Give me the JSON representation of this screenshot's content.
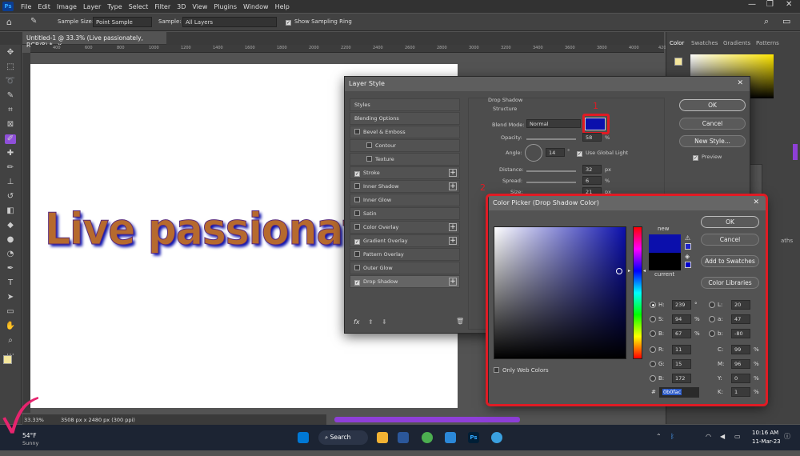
{
  "menu": {
    "logo": "Ps",
    "items": [
      "File",
      "Edit",
      "Image",
      "Layer",
      "Type",
      "Select",
      "Filter",
      "3D",
      "View",
      "Plugins",
      "Window",
      "Help"
    ]
  },
  "options": {
    "sample_size_label": "Sample Size:",
    "sample_size_value": "Point Sample",
    "sample_label": "Sample:",
    "sample_value": "All Layers",
    "show_ring_label": "Show Sampling Ring"
  },
  "document": {
    "tab_title": "Untitled-1 @ 33.3% (Live passionately, RGB/8) *",
    "zoom": "33.33%",
    "size_info": "3508 px x 2480 px (300 ppi)",
    "canvas_text": "Live passionately"
  },
  "ruler_ticks": [
    "400",
    "600",
    "800",
    "1000",
    "1200",
    "1400",
    "1600",
    "1800",
    "2000",
    "2200",
    "2400",
    "2600",
    "2800",
    "3000",
    "3200",
    "3400",
    "3600",
    "3800",
    "4000",
    "4200"
  ],
  "right_panel": {
    "tabs": [
      "Color",
      "Swatches",
      "Gradients",
      "Patterns"
    ],
    "partial": "aths"
  },
  "layer_style": {
    "title": "Layer Style",
    "items": [
      {
        "label": "Styles",
        "check": null,
        "plus": false
      },
      {
        "label": "Blending Options",
        "check": null,
        "plus": false
      },
      {
        "label": "Bevel & Emboss",
        "check": false,
        "plus": false
      },
      {
        "label": "Contour",
        "check": false,
        "plus": false,
        "indent": true
      },
      {
        "label": "Texture",
        "check": false,
        "plus": false,
        "indent": true
      },
      {
        "label": "Stroke",
        "check": true,
        "plus": true
      },
      {
        "label": "Inner Shadow",
        "check": false,
        "plus": true
      },
      {
        "label": "Inner Glow",
        "check": false,
        "plus": false
      },
      {
        "label": "Satin",
        "check": false,
        "plus": false
      },
      {
        "label": "Color Overlay",
        "check": false,
        "plus": true
      },
      {
        "label": "Gradient Overlay",
        "check": true,
        "plus": true
      },
      {
        "label": "Pattern Overlay",
        "check": false,
        "plus": false
      },
      {
        "label": "Outer Glow",
        "check": false,
        "plus": false
      },
      {
        "label": "Drop Shadow",
        "check": true,
        "plus": true,
        "selected": true
      }
    ],
    "fx": "fx",
    "section": "Drop Shadow",
    "subsection": "Structure",
    "blend_mode_label": "Blend Mode:",
    "blend_mode_value": "Normal",
    "opacity_label": "Opacity:",
    "opacity_value": "58",
    "opacity_unit": "%",
    "angle_label": "Angle:",
    "angle_value": "14",
    "angle_unit": "°",
    "global_light_label": "Use Global Light",
    "distance_label": "Distance:",
    "distance_value": "32",
    "distance_unit": "px",
    "spread_label": "Spread:",
    "spread_value": "6",
    "spread_unit": "%",
    "size_label": "Size:",
    "size_value": "21",
    "size_unit": "px",
    "ok": "OK",
    "cancel": "Cancel",
    "new_style": "New Style...",
    "preview": "Preview",
    "shadow_color": "#0b0fac"
  },
  "annotations": {
    "one": "1",
    "two": "2"
  },
  "color_picker": {
    "title": "Color Picker (Drop Shadow Color)",
    "ok": "OK",
    "cancel": "Cancel",
    "add_swatches": "Add to Swatches",
    "color_libraries": "Color Libraries",
    "new_label": "new",
    "current_label": "current",
    "only_web_colors": "Only Web Colors",
    "new_color": "#0b0fac",
    "current_color": "#000000",
    "H": {
      "label": "H:",
      "value": "239",
      "unit": "°"
    },
    "S": {
      "label": "S:",
      "value": "94",
      "unit": "%"
    },
    "Bv": {
      "label": "B:",
      "value": "67",
      "unit": "%"
    },
    "R": {
      "label": "R:",
      "value": "11"
    },
    "G": {
      "label": "G:",
      "value": "15"
    },
    "Bc": {
      "label": "B:",
      "value": "172"
    },
    "L": {
      "label": "L:",
      "value": "20"
    },
    "a": {
      "label": "a:",
      "value": "47"
    },
    "b": {
      "label": "b:",
      "value": "-80"
    },
    "C": {
      "label": "C:",
      "value": "99",
      "unit": "%"
    },
    "M": {
      "label": "M:",
      "value": "96",
      "unit": "%"
    },
    "Y": {
      "label": "Y:",
      "value": "0",
      "unit": "%"
    },
    "K": {
      "label": "K:",
      "value": "1",
      "unit": "%"
    },
    "hex_label": "#",
    "hex": "0b0fac"
  },
  "taskbar": {
    "weather_temp": "54°F",
    "weather_desc": "Sunny",
    "search": "Search",
    "time": "10:16 AM",
    "date": "11-Mar-23"
  }
}
